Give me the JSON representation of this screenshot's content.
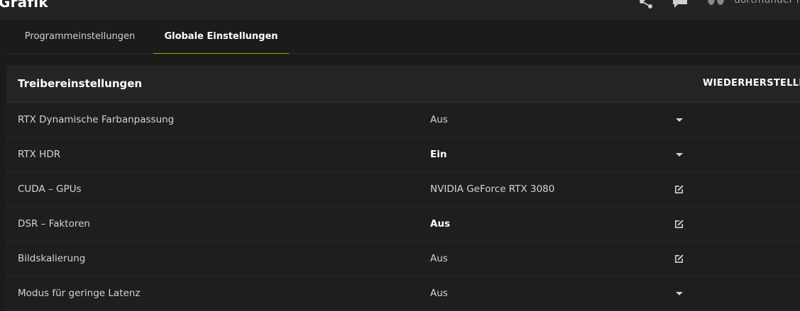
{
  "header": {
    "title": "Grafik",
    "username": "dortmunder rs",
    "icons": [
      "share-icon",
      "feedback-icon",
      "avatar-icon"
    ]
  },
  "tabs": [
    {
      "label": "Programmeinstellungen",
      "active": false
    },
    {
      "label": "Globale Einstellungen",
      "active": true
    }
  ],
  "section": {
    "title": "Treibereinstellungen",
    "restore_label": "WIEDERHERSTELLEN"
  },
  "settings": [
    {
      "label": "RTX Dynamische Farbanpassung",
      "value": "Aus",
      "control": "chevron-down-icon",
      "emphasis": false
    },
    {
      "label": "RTX HDR",
      "value": "Ein",
      "control": "chevron-down-icon",
      "emphasis": true
    },
    {
      "label": "CUDA – GPUs",
      "value": "NVIDIA GeForce RTX 3080",
      "control": "edit-icon",
      "emphasis": false
    },
    {
      "label": "DSR – Faktoren",
      "value": "Aus",
      "control": "edit-icon",
      "emphasis": true
    },
    {
      "label": "Bildskalierung",
      "value": "Aus",
      "control": "edit-icon",
      "emphasis": false
    },
    {
      "label": "Modus für geringe Latenz",
      "value": "Aus",
      "control": "chevron-down-icon",
      "emphasis": false
    }
  ],
  "colors": {
    "accent": "#76b900",
    "background": "#1b1b1b",
    "header_bg": "#242424"
  }
}
